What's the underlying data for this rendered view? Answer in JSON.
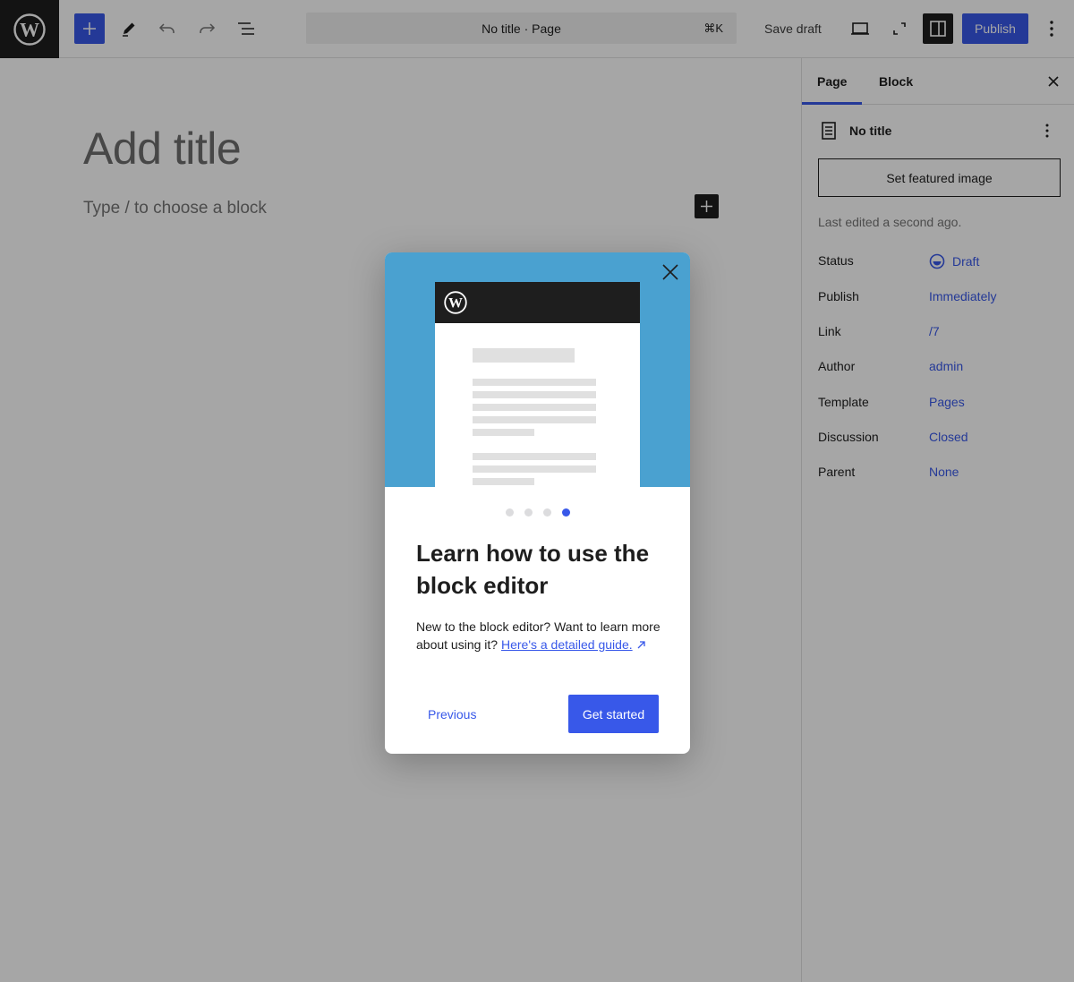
{
  "toolbar": {
    "command_bar": "No title · Page",
    "command_shortcut": "⌘K",
    "save_draft": "Save draft",
    "publish": "Publish"
  },
  "editor": {
    "title_placeholder": "Add title",
    "block_placeholder": "Type / to choose a block"
  },
  "sidebar": {
    "tabs": [
      {
        "label": "Page",
        "active": true
      },
      {
        "label": "Block",
        "active": false
      }
    ],
    "doc_title": "No title",
    "featured_image": "Set featured image",
    "last_edited": "Last edited a second ago.",
    "meta": [
      {
        "label": "Status",
        "value": "Draft"
      },
      {
        "label": "Publish",
        "value": "Immediately"
      },
      {
        "label": "Link",
        "value": "/7"
      },
      {
        "label": "Author",
        "value": "admin"
      },
      {
        "label": "Template",
        "value": "Pages"
      },
      {
        "label": "Discussion",
        "value": "Closed"
      },
      {
        "label": "Parent",
        "value": "None"
      }
    ]
  },
  "guide": {
    "heading": "Learn how to use the block editor",
    "text": "New to the block editor? Want to learn more about using it?",
    "link": "Here's a detailed guide.",
    "previous": "Previous",
    "get_started": "Get started",
    "pages": 4,
    "current_page": 4
  },
  "colors": {
    "accent": "#3858e9",
    "dark": "#1e1e1e",
    "art_background": "#4aa1d0"
  },
  "icons": [
    "wordpress-logo-icon",
    "plus-icon",
    "pencil-icon",
    "undo-icon",
    "redo-icon",
    "list-view-icon",
    "desktop-preview-icon",
    "fullscreen-icon",
    "sidebar-icon",
    "more-vertical-icon",
    "close-icon",
    "page-icon",
    "draft-status-icon",
    "external-link-icon"
  ]
}
